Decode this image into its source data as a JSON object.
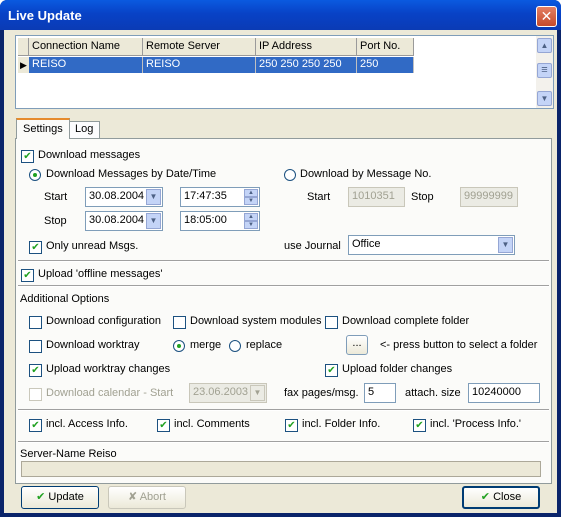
{
  "window": {
    "title": "Live Update",
    "close_glyph": "✕"
  },
  "grid": {
    "columns": [
      "Connection Name",
      "Remote Server",
      "IP Address",
      "Port No."
    ],
    "rows": [
      {
        "marker": "▶",
        "cells": [
          "REISO",
          "REISO",
          "250 250 250 250",
          "250"
        ]
      }
    ],
    "scroll_up": "▲",
    "scroll_down": "▼",
    "scroll_thumb": "≡"
  },
  "tabs": [
    {
      "label": "Settings"
    },
    {
      "label": "Log"
    }
  ],
  "download": {
    "download_messages": "Download messages",
    "by_date_label": "Download Messages by Date/Time",
    "by_number_label": "Download by Message No.",
    "start_label": "Start",
    "stop_label": "Stop",
    "start_date": "30.08.2004",
    "start_time": "17:47:35",
    "stop_date": "30.08.2004",
    "stop_time": "18:05:00",
    "num_start_label": "Start",
    "num_stop_label": "Stop",
    "num_start": "1010351",
    "num_stop": "99999999",
    "only_unread": "Only unread Msgs.",
    "use_journal_label": "use Journal",
    "journal": "Office"
  },
  "upload_offline": "Upload  'offline messages'",
  "additional": {
    "heading": "Additional Options",
    "download_configuration": "Download configuration",
    "download_system_modules": "Download system modules",
    "download_complete_folder": "Download complete folder",
    "download_worktray": "Download worktray",
    "merge": "merge",
    "replace": "replace",
    "browse_button": "...",
    "browse_hint": "<- press button to select a folder",
    "upload_worktray": "Upload worktray changes",
    "upload_folder": "Upload folder changes",
    "download_calendar": "Download calendar  -  Start",
    "calendar_start": "23.06.2003",
    "fax_label": "fax pages/msg.",
    "fax_value": "5",
    "attach_label": "attach. size",
    "attach_value": "10240000"
  },
  "incl": {
    "access": "incl. Access Info.",
    "comments": "incl. Comments",
    "folder": "incl. Folder Info.",
    "process": "incl. 'Process Info.'"
  },
  "server_name": "Server-Name Reiso",
  "buttons": {
    "update": "Update",
    "abort": "Abort",
    "close": "Close"
  },
  "icons": {
    "check_mark": "✔",
    "abort_mark": "✘",
    "dropdown": "▼",
    "spin_up": "▲",
    "spin_down": "▼"
  }
}
